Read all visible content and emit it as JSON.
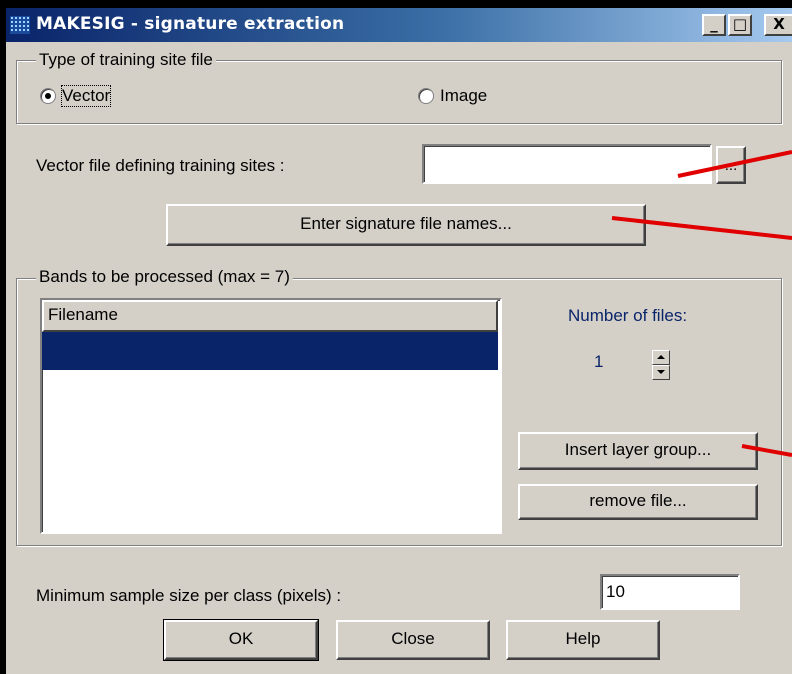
{
  "window": {
    "title": "MAKESIG - signature extraction",
    "controls": {
      "minimize": "_",
      "maximize": "□",
      "close": "X"
    }
  },
  "training_type": {
    "legend": "Type of training site file",
    "options": [
      {
        "label": "Vector",
        "selected": true
      },
      {
        "label": "Image",
        "selected": false
      }
    ]
  },
  "vector_file": {
    "label": "Vector file defining training sites :",
    "value": "",
    "browse_label": "..."
  },
  "enter_names_button": "Enter signature file names...",
  "bands": {
    "legend": "Bands to be processed (max = 7)",
    "column_header": "Filename",
    "rows": [
      ""
    ],
    "number_of_files_label": "Number of files:",
    "number_of_files_value": "1",
    "insert_button": "Insert layer group...",
    "remove_button": "remove file..."
  },
  "min_sample": {
    "label": "Minimum sample size per class (pixels) :",
    "value": "10"
  },
  "buttons": {
    "ok": "OK",
    "close": "Close",
    "help": "Help"
  },
  "colors": {
    "face": "#d4d0c8",
    "title_start": "#0a246a",
    "selection": "#0a246a",
    "accent_text": "#0a246a",
    "annotation": "#e00000",
    "background": "#000000"
  },
  "icons": [
    "app-grid-icon",
    "minimize-icon",
    "maximize-icon",
    "close-icon",
    "spin-up-icon",
    "spin-down-icon"
  ]
}
